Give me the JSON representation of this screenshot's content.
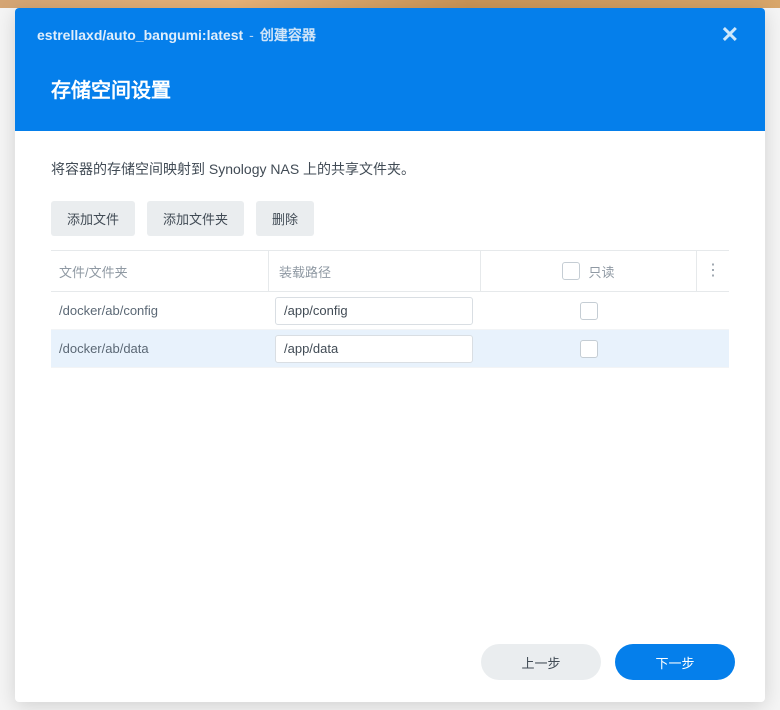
{
  "header": {
    "image_name": "estrellaxd/auto_bangumi:latest",
    "separator": "-",
    "create_label": "创建容器",
    "section_title": "存储空间设置"
  },
  "body": {
    "description": "将容器的存储空间映射到 Synology NAS 上的共享文件夹。",
    "toolbar": {
      "add_file": "添加文件",
      "add_folder": "添加文件夹",
      "delete": "删除"
    },
    "table": {
      "headers": {
        "file": "文件/文件夹",
        "mount": "装载路径",
        "readonly": "只读"
      },
      "rows": [
        {
          "file": "/docker/ab/config",
          "mount": "/app/config",
          "readonly": false,
          "selected": false
        },
        {
          "file": "/docker/ab/data",
          "mount": "/app/data",
          "readonly": false,
          "selected": true
        }
      ]
    }
  },
  "footer": {
    "prev": "上一步",
    "next": "下一步"
  }
}
